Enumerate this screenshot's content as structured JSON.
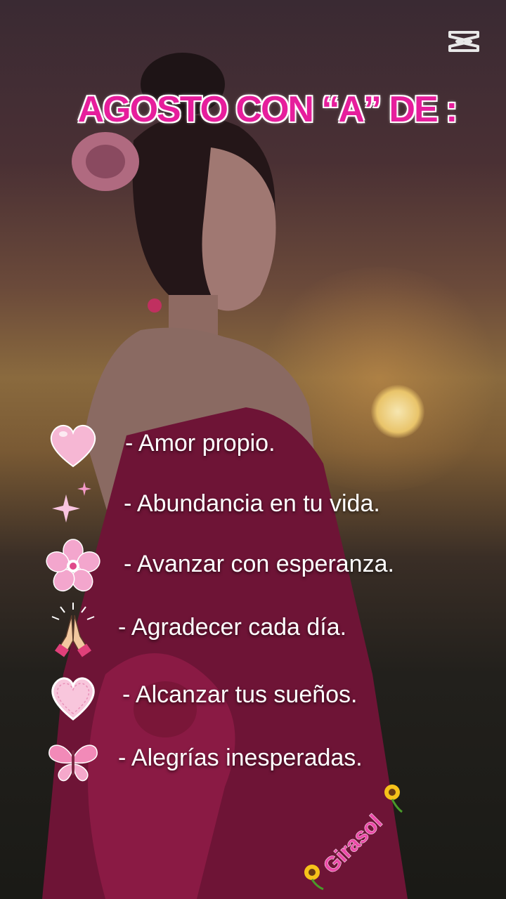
{
  "title": "AGOSTO CON “A” DE :",
  "items": [
    {
      "icon": "pink-heart-icon",
      "text": "- Amor propio."
    },
    {
      "icon": "sparkles-icon",
      "text": "- Abundancia en tu vida."
    },
    {
      "icon": "cherry-blossom-icon",
      "text": "- Avanzar con esperanza."
    },
    {
      "icon": "praying-hands-icon",
      "text": "- Agradecer cada día."
    },
    {
      "icon": "light-pink-heart-icon",
      "text": "- Alcanzar tus sueños."
    },
    {
      "icon": "butterfly-icon",
      "text": "- Alegrías inesperadas."
    }
  ],
  "watermark": "Girasol",
  "colors": {
    "title_pink": "#e61e9c",
    "heart_pink": "#f6b7d4",
    "dress": "#8a1a44"
  }
}
